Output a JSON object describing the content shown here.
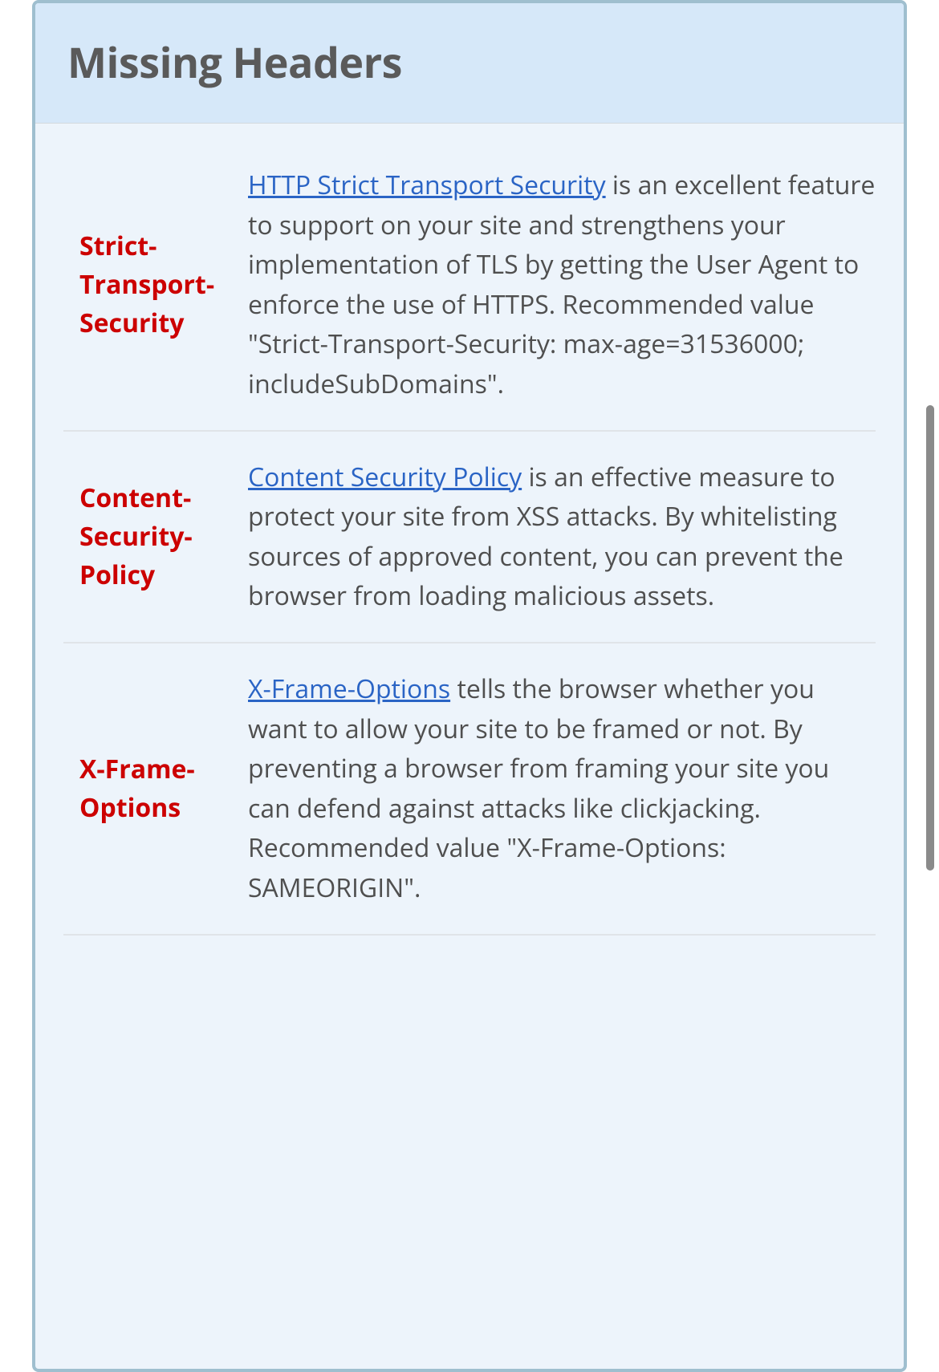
{
  "panel": {
    "title": "Missing Headers"
  },
  "headers": [
    {
      "name": "Strict-Transport-Security",
      "link_text": "HTTP Strict Transport Security",
      "desc_after": " is an excellent feature to support on your site and strengthens your implementation of TLS by getting the User Agent to enforce the use of HTTPS. Recommended value \"Strict-Transport-Security: max-age=31536000; includeSubDomains\"."
    },
    {
      "name": "Content-Security-Policy",
      "link_text": "Content Security Policy",
      "desc_after": " is an effective measure to protect your site from XSS attacks. By whitelisting sources of approved content, you can prevent the browser from loading malicious assets."
    },
    {
      "name": "X-Frame-Options",
      "link_text": "X-Frame-Options",
      "desc_after": " tells the browser whether you want to allow your site to be framed or not. By preventing a browser from framing your site you can defend against attacks like clickjacking. Recommended value \"X-Frame-Options: SAMEORIGIN\"."
    }
  ]
}
